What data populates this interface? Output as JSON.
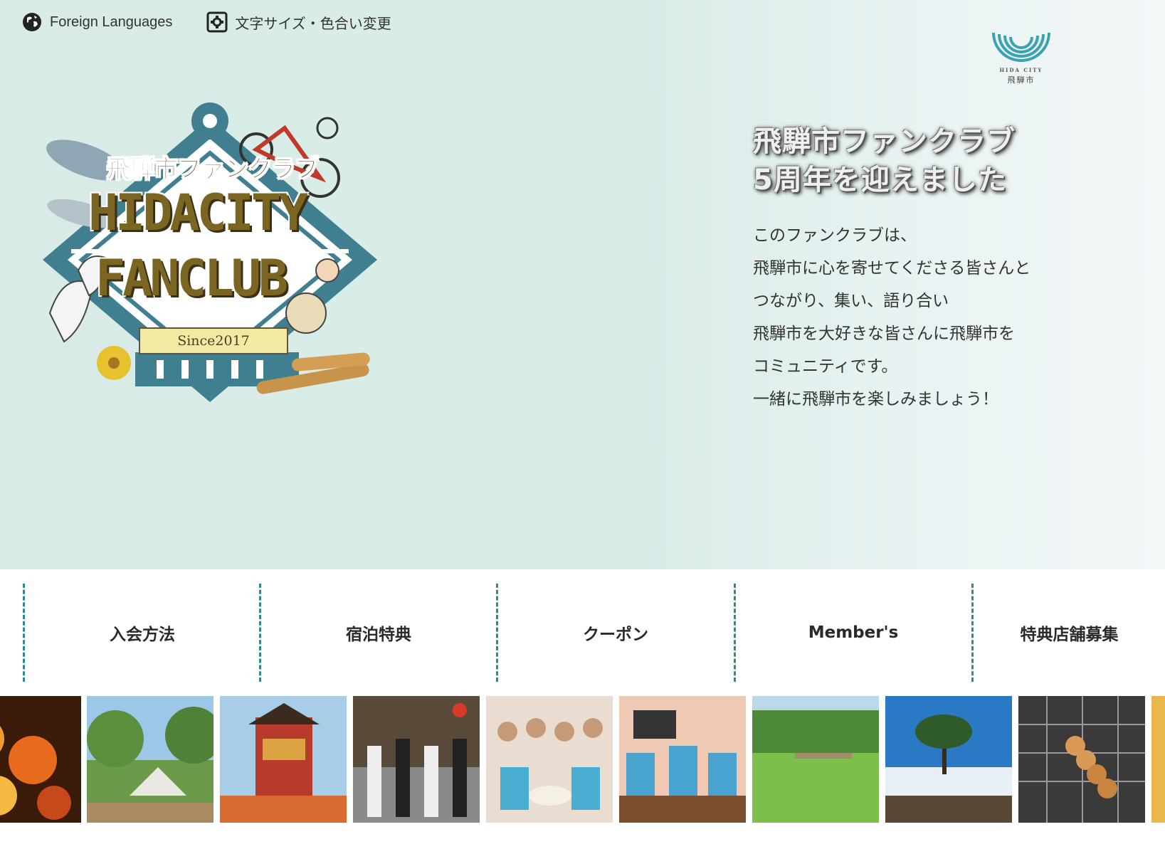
{
  "topbar": {
    "languages_label": "Foreign Languages",
    "accessibility_label": "文字サイズ・色合い変更"
  },
  "city_logo": {
    "en": "HIDA CITY",
    "jp": "飛騨市"
  },
  "emblem": {
    "title_jp": "飛騨市ファンクラブ",
    "title_line1": "HIDACITY",
    "title_line2": "FANCLUB",
    "since": "Since2017"
  },
  "hero": {
    "headline_line1": "飛騨市ファンクラブ",
    "headline_line2": "5周年を迎えました",
    "intro_lines": [
      "このファンクラブは、",
      "飛騨市に心を寄せてくださる皆さんと",
      "つながり、集い、語り合い",
      "飛騨市を大好きな皆さんに飛騨市を",
      "コミュニティです。",
      "一緒に飛騨市を楽しみましょう！"
    ]
  },
  "nav": {
    "items": [
      {
        "label": "入会方法"
      },
      {
        "label": "宿泊特典"
      },
      {
        "label": "クーポン"
      },
      {
        "label": "Member's"
      },
      {
        "label": "特典店舗募集"
      }
    ]
  },
  "photos": [
    {
      "name": "photo-candles"
    },
    {
      "name": "photo-tent"
    },
    {
      "name": "photo-float"
    },
    {
      "name": "photo-parade"
    },
    {
      "name": "photo-members-group"
    },
    {
      "name": "photo-event-hall"
    },
    {
      "name": "photo-wetland"
    },
    {
      "name": "photo-sea-of-clouds"
    },
    {
      "name": "photo-dango"
    }
  ],
  "colors": {
    "accent": "#2e8a8d",
    "hero_bg": "#d9ece8",
    "emblem_teal": "#3f7f8f"
  }
}
